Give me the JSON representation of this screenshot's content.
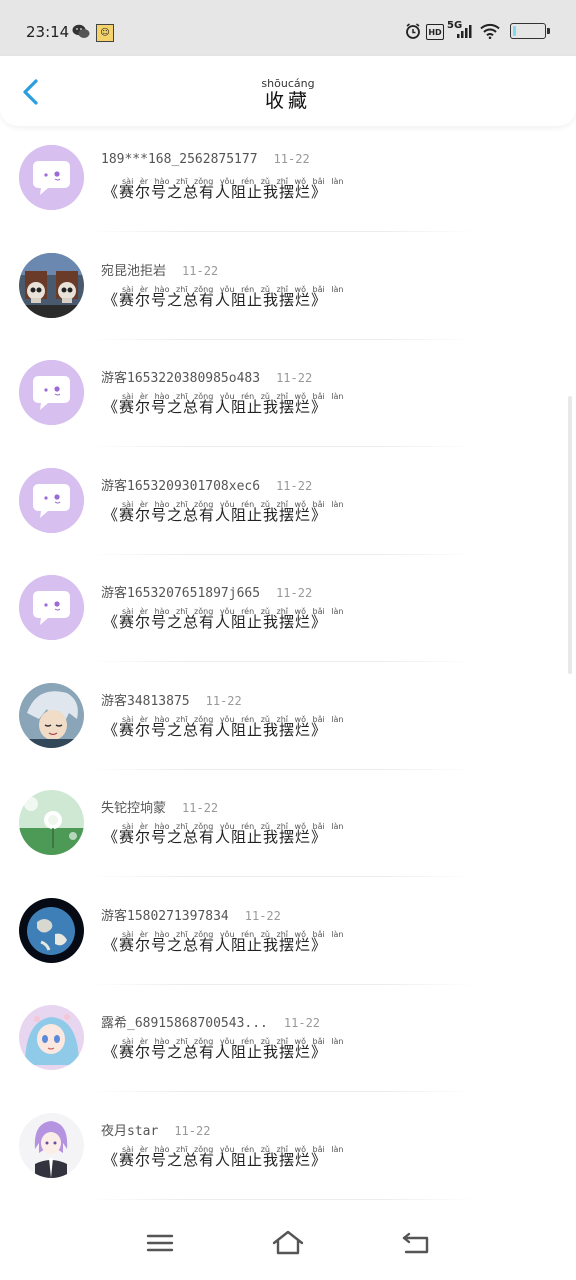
{
  "status": {
    "time": "23:14",
    "network": "5G",
    "hd_label": "HD",
    "icons": [
      "wechat-icon",
      "app-notification-icon",
      "alarm-icon",
      "hd-icon",
      "signal-icon",
      "wifi-icon",
      "battery-icon"
    ],
    "battery_level": 0.08
  },
  "header": {
    "title": "收藏",
    "title_pinyin": "shōucáng"
  },
  "work_title": "《赛尔号之总有人阻止我摆烂》",
  "work_pinyin": "sài èr hào zhī zǒng yǒu rén zǔ zhǐ wǒ bǎi làn",
  "colors": {
    "accent": "#2a9fe0",
    "default_avatar_bg": "#d7bff0",
    "default_avatar_fg": "#9b6ad6"
  },
  "items": [
    {
      "name": "189***168_2562875177",
      "date": "11-22",
      "avatar": "default"
    },
    {
      "name": "宛昆池拒岩",
      "date": "11-22",
      "avatar": "skulls"
    },
    {
      "name": "游客1653220380985o483",
      "date": "11-22",
      "avatar": "default"
    },
    {
      "name": "游客1653209301708xec6",
      "date": "11-22",
      "avatar": "default"
    },
    {
      "name": "游客1653207651897j665",
      "date": "11-22",
      "avatar": "default"
    },
    {
      "name": "游客34813875",
      "date": "11-22",
      "avatar": "anime-boy"
    },
    {
      "name": "失铊控垧蒙",
      "date": "11-22",
      "avatar": "dandelion"
    },
    {
      "name": "游客1580271397834",
      "date": "11-22",
      "avatar": "earth"
    },
    {
      "name": "露希_68915868700543...",
      "date": "11-22",
      "avatar": "anime-girl"
    },
    {
      "name": "夜月star",
      "date": "11-22",
      "avatar": "anime-purple"
    }
  ],
  "navbar": {
    "icons": [
      "menu-icon",
      "home-icon",
      "back-nav-icon"
    ]
  }
}
